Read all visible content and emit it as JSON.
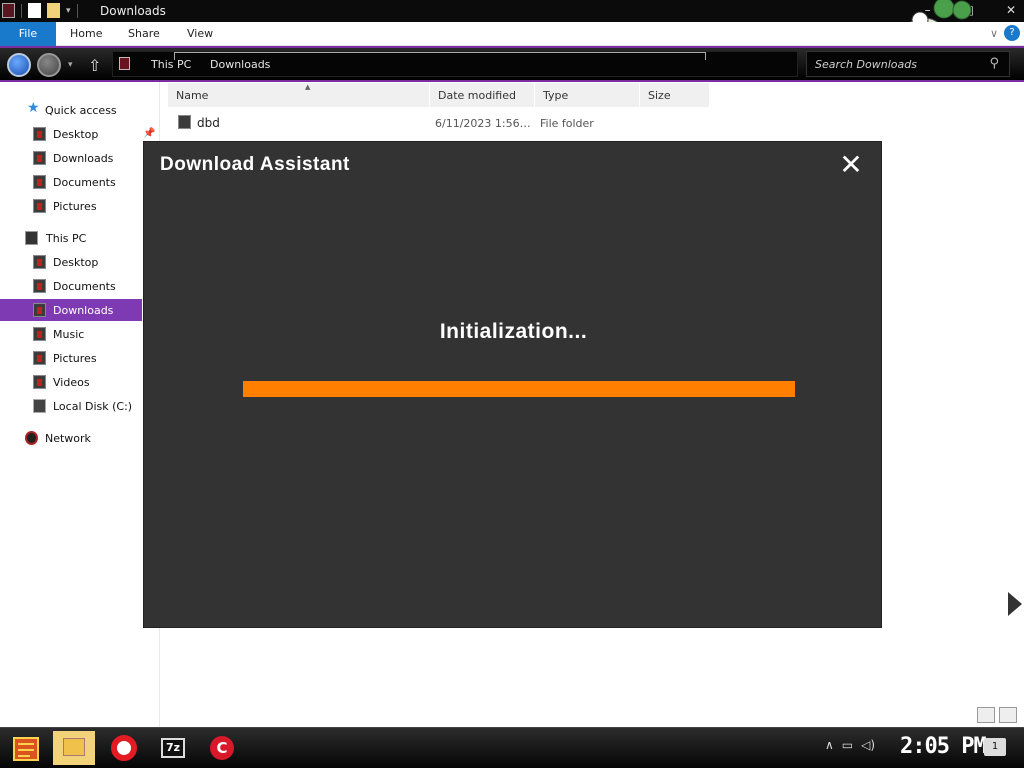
{
  "window": {
    "title": "Downloads"
  },
  "ribbon": {
    "file": "File",
    "home": "Home",
    "share": "Share",
    "view": "View"
  },
  "address": {
    "crumbs": [
      "This PC",
      "Downloads"
    ],
    "search_placeholder": "Search Downloads"
  },
  "sidebar": {
    "quick_access": "Quick access",
    "quick_items": [
      "Desktop",
      "Downloads",
      "Documents",
      "Pictures"
    ],
    "this_pc": "This PC",
    "pc_items": [
      "Desktop",
      "Documents",
      "Downloads",
      "Music",
      "Pictures",
      "Videos",
      "Local Disk (C:)"
    ],
    "network": "Network",
    "selected": "Downloads"
  },
  "filelist": {
    "columns": [
      "Name",
      "Date modified",
      "Type",
      "Size"
    ],
    "rows": [
      {
        "name": "dbd",
        "date": "6/11/2023 1:56…",
        "type": "File folder",
        "size": ""
      }
    ]
  },
  "dialog": {
    "title": "Download Assistant",
    "status": "Initialization...",
    "progress": 1.0,
    "accent_color": "#ff7f00",
    "background_color": "#333333"
  },
  "taskbar": {
    "apps": [
      "file-explorer",
      "opera",
      "7-zip",
      "ccleaner"
    ],
    "sevenzip_label": "7z",
    "ccleaner_label": "C",
    "clock": "2:05 PM",
    "notifications": "1"
  }
}
